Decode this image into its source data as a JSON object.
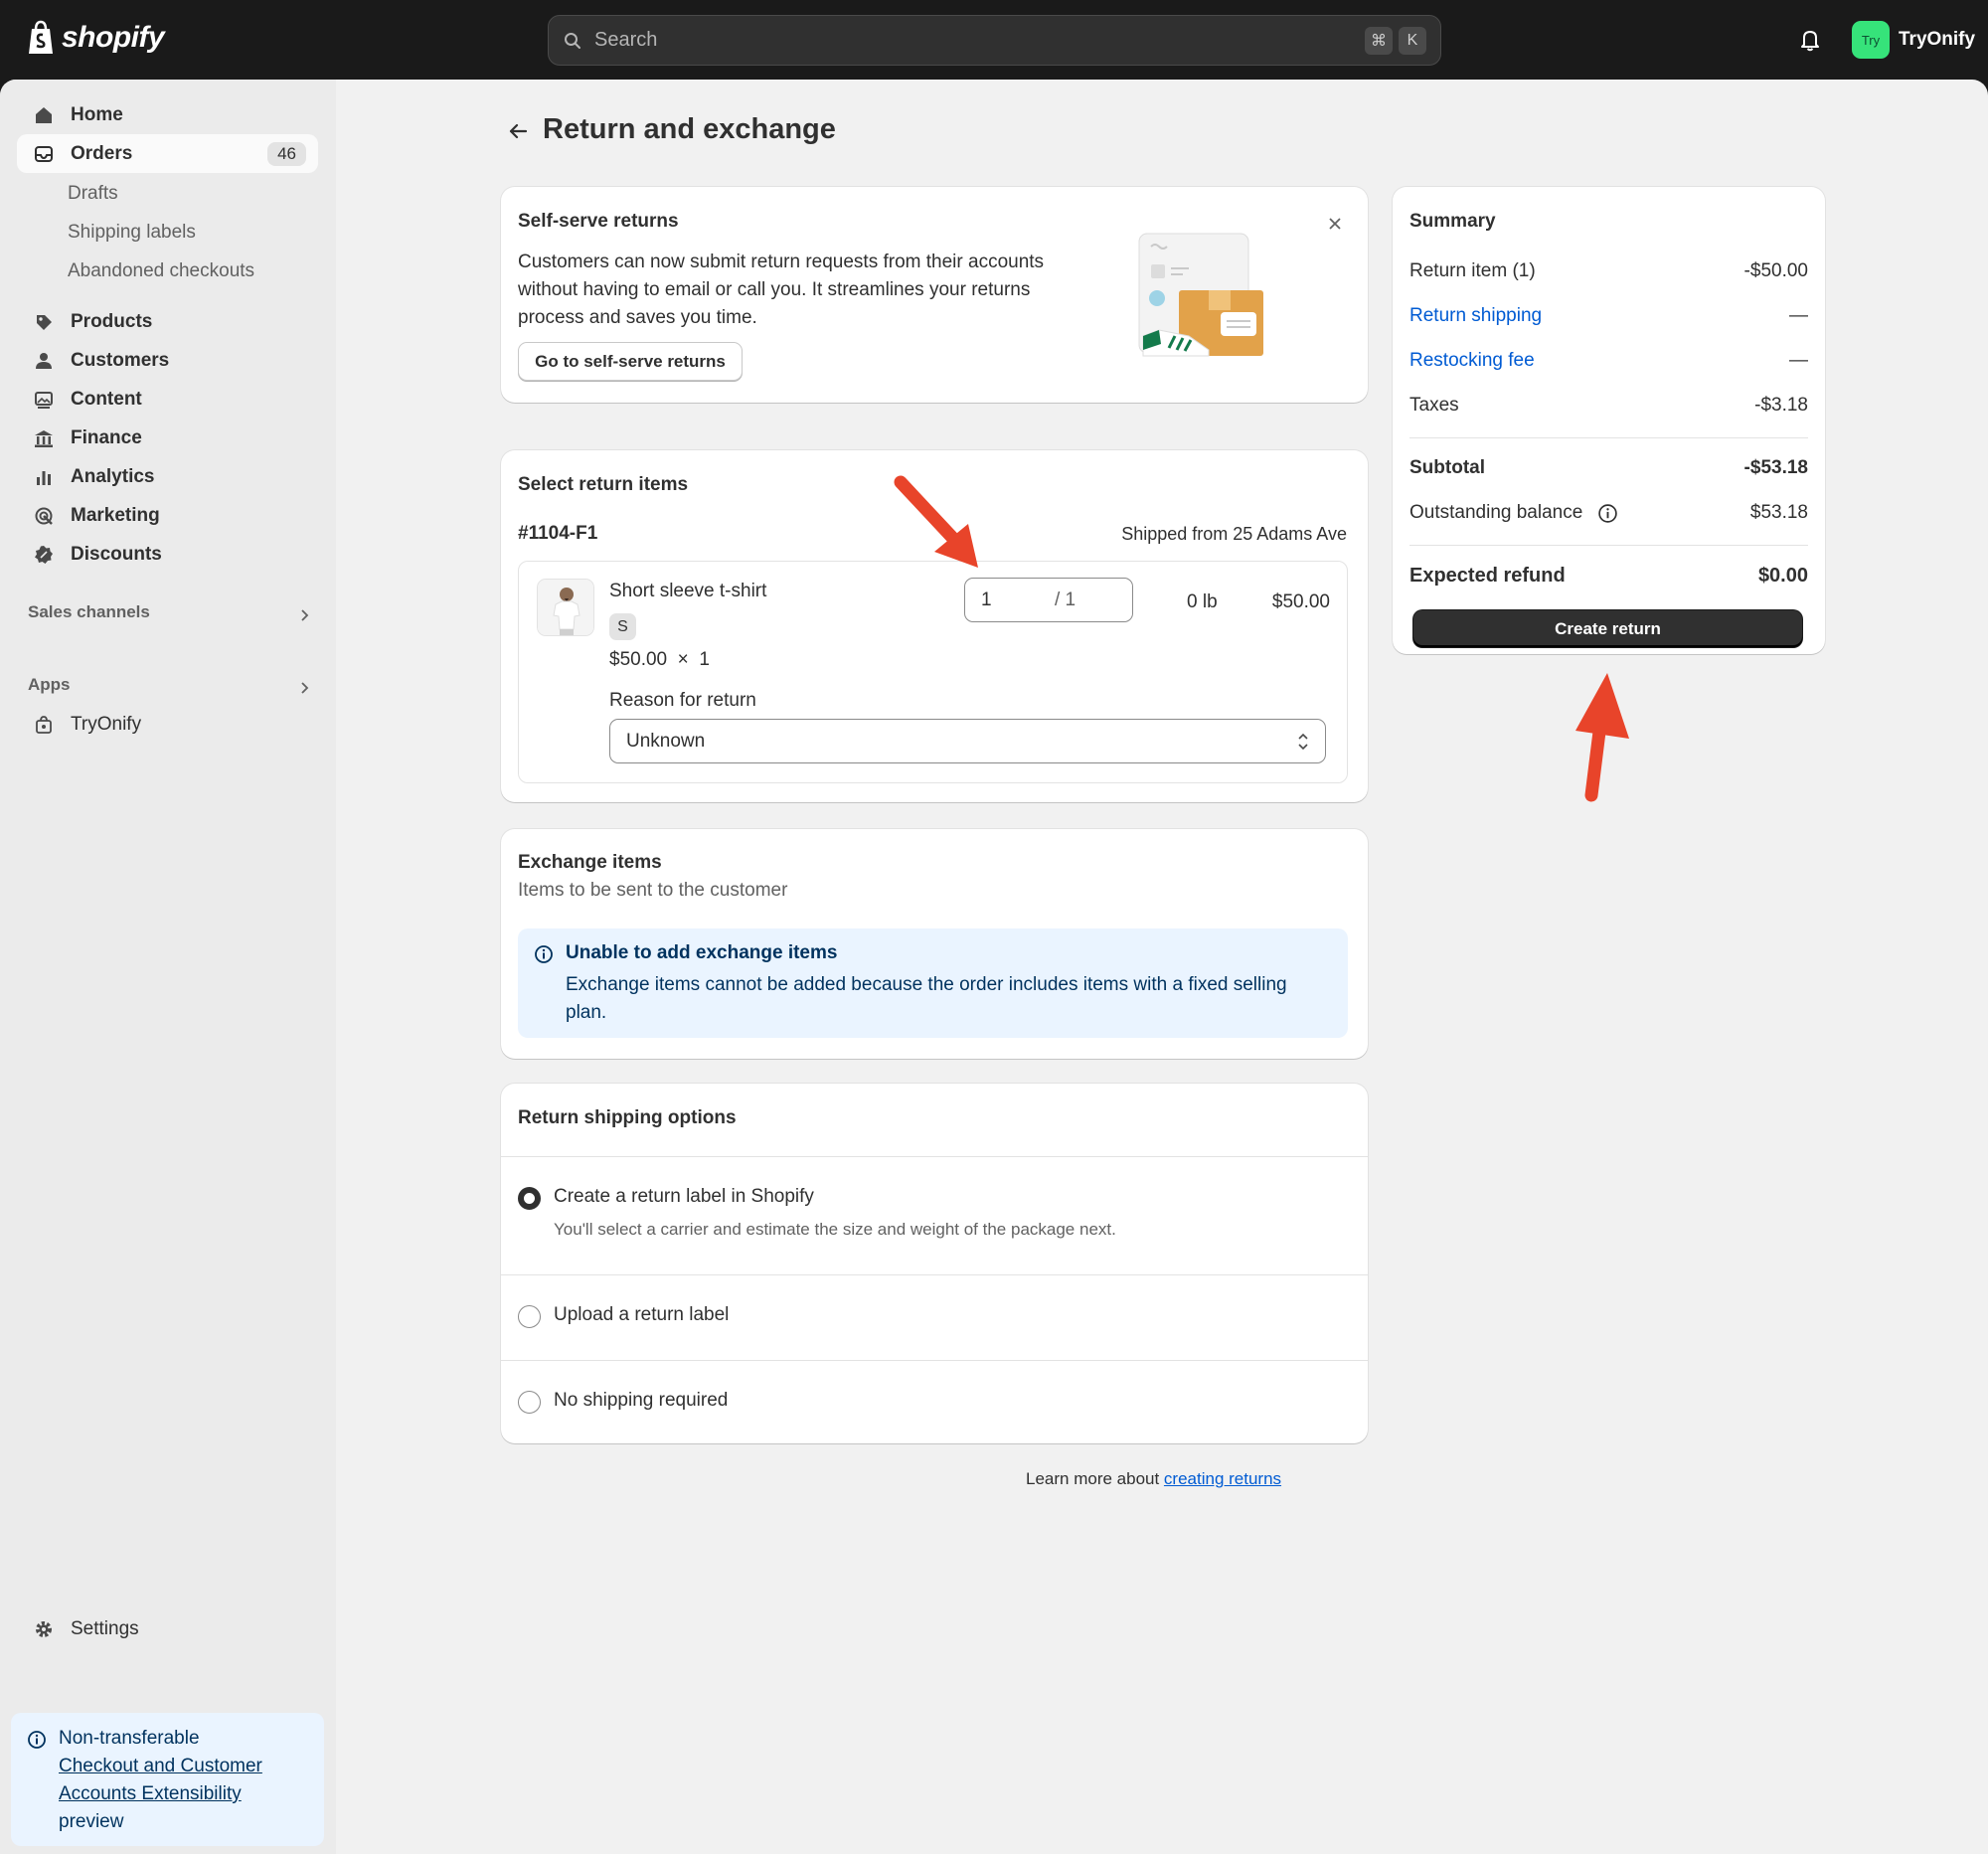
{
  "topbar": {
    "logo_text": "shopify",
    "search_placeholder": "Search",
    "shortcut_keys": [
      "⌘",
      "K"
    ],
    "avatar_initials": "Try",
    "store_name": "TryOnify"
  },
  "sidebar": {
    "home": "Home",
    "orders": "Orders",
    "orders_count": "46",
    "orders_sub": [
      "Drafts",
      "Shipping labels",
      "Abandoned checkouts"
    ],
    "products": "Products",
    "customers": "Customers",
    "content": "Content",
    "finance": "Finance",
    "analytics": "Analytics",
    "marketing": "Marketing",
    "discounts": "Discounts",
    "sales_channels": "Sales channels",
    "apps": "Apps",
    "app_tryonify": "TryOnify",
    "settings": "Settings",
    "preview": {
      "line1": "Non-transferable",
      "link": "Checkout and Customer Accounts Extensibility",
      "line3": "preview"
    }
  },
  "page": {
    "title": "Return and exchange"
  },
  "self_serve": {
    "title": "Self-serve returns",
    "body_lines": [
      "Customers can now submit return requests from their accounts",
      "without having to email or call you. It streamlines your returns",
      "process and saves you time."
    ],
    "button": "Go to self-serve returns"
  },
  "return_items": {
    "title": "Select return items",
    "fulfillment_id": "#1104-F1",
    "shipped_from": "Shipped from 25 Adams Ave",
    "product_name": "Short sleeve t-shirt",
    "variant": "S",
    "price_line": "$50.00  ×  1",
    "qty_value": "1",
    "qty_max": "/ 1",
    "weight": "0 lb",
    "line_total": "$50.00",
    "reason_label": "Reason for return",
    "reason_value": "Unknown"
  },
  "exchange": {
    "title": "Exchange items",
    "subtitle": "Items to be sent to the customer",
    "banner_title": "Unable to add exchange items",
    "banner_body_lines": [
      "Exchange items cannot be added because the order includes items with a fixed selling",
      "plan."
    ]
  },
  "shipping": {
    "title": "Return shipping options",
    "options": [
      {
        "label": "Create a return label in Shopify",
        "help": "You'll select a carrier and estimate the size and weight of the package next.",
        "selected": true
      },
      {
        "label": "Upload a return label",
        "selected": false
      },
      {
        "label": "No shipping required",
        "selected": false
      }
    ]
  },
  "footer": {
    "learn_prefix": "Learn more about ",
    "learn_link": "creating returns"
  },
  "summary": {
    "title": "Summary",
    "rows": [
      {
        "label": "Return item (1)",
        "value": "-$50.00"
      },
      {
        "label": "Return shipping",
        "value": "—"
      },
      {
        "label": "Restocking fee",
        "value": "—"
      },
      {
        "label": "Taxes",
        "value": "-$3.18"
      }
    ],
    "subtotal_label": "Subtotal",
    "subtotal_value": "-$53.18",
    "outstanding_label": "Outstanding balance",
    "outstanding_value": "$53.18",
    "expected_label": "Expected refund",
    "expected_value": "$0.00",
    "create_button": "Create return"
  },
  "colors": {
    "accent_link": "#005bd3",
    "annotation_arrow": "#e8442a",
    "avatar": "#36e37a"
  }
}
